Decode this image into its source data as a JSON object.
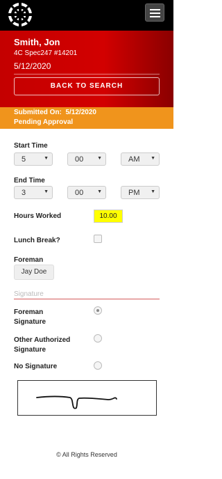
{
  "header": {
    "logo_icon": "circular-crosshair-logo",
    "menu_icon": "hamburger-menu-icon"
  },
  "employee": {
    "name": "Smith, Jon",
    "job": "4C Spec247 #14201",
    "date": "5/12/2020"
  },
  "back_button": "BACK TO SEARCH",
  "status": {
    "submitted_label": "Submitted On:",
    "submitted_date": "5/12/2020",
    "state": "Pending Approval"
  },
  "start_time": {
    "label": "Start Time",
    "hour": "5",
    "minute": "00",
    "ampm": "AM"
  },
  "end_time": {
    "label": "End Time",
    "hour": "3",
    "minute": "00",
    "ampm": "PM"
  },
  "hours_worked": {
    "label": "Hours Worked",
    "value": "10.00"
  },
  "lunch_break": {
    "label": "Lunch Break?",
    "checked": false
  },
  "foreman": {
    "label": "Foreman",
    "value": "Jay Doe"
  },
  "signature": {
    "legend": "Signature",
    "options": [
      {
        "label_line1": "Foreman",
        "label_line2": "Signature",
        "checked": true
      },
      {
        "label_line1": "Other Authorized",
        "label_line2": "Signature",
        "checked": false
      },
      {
        "label_line1": "No Signature",
        "label_line2": "",
        "checked": false
      }
    ]
  },
  "footer": "© All Rights Reserved"
}
